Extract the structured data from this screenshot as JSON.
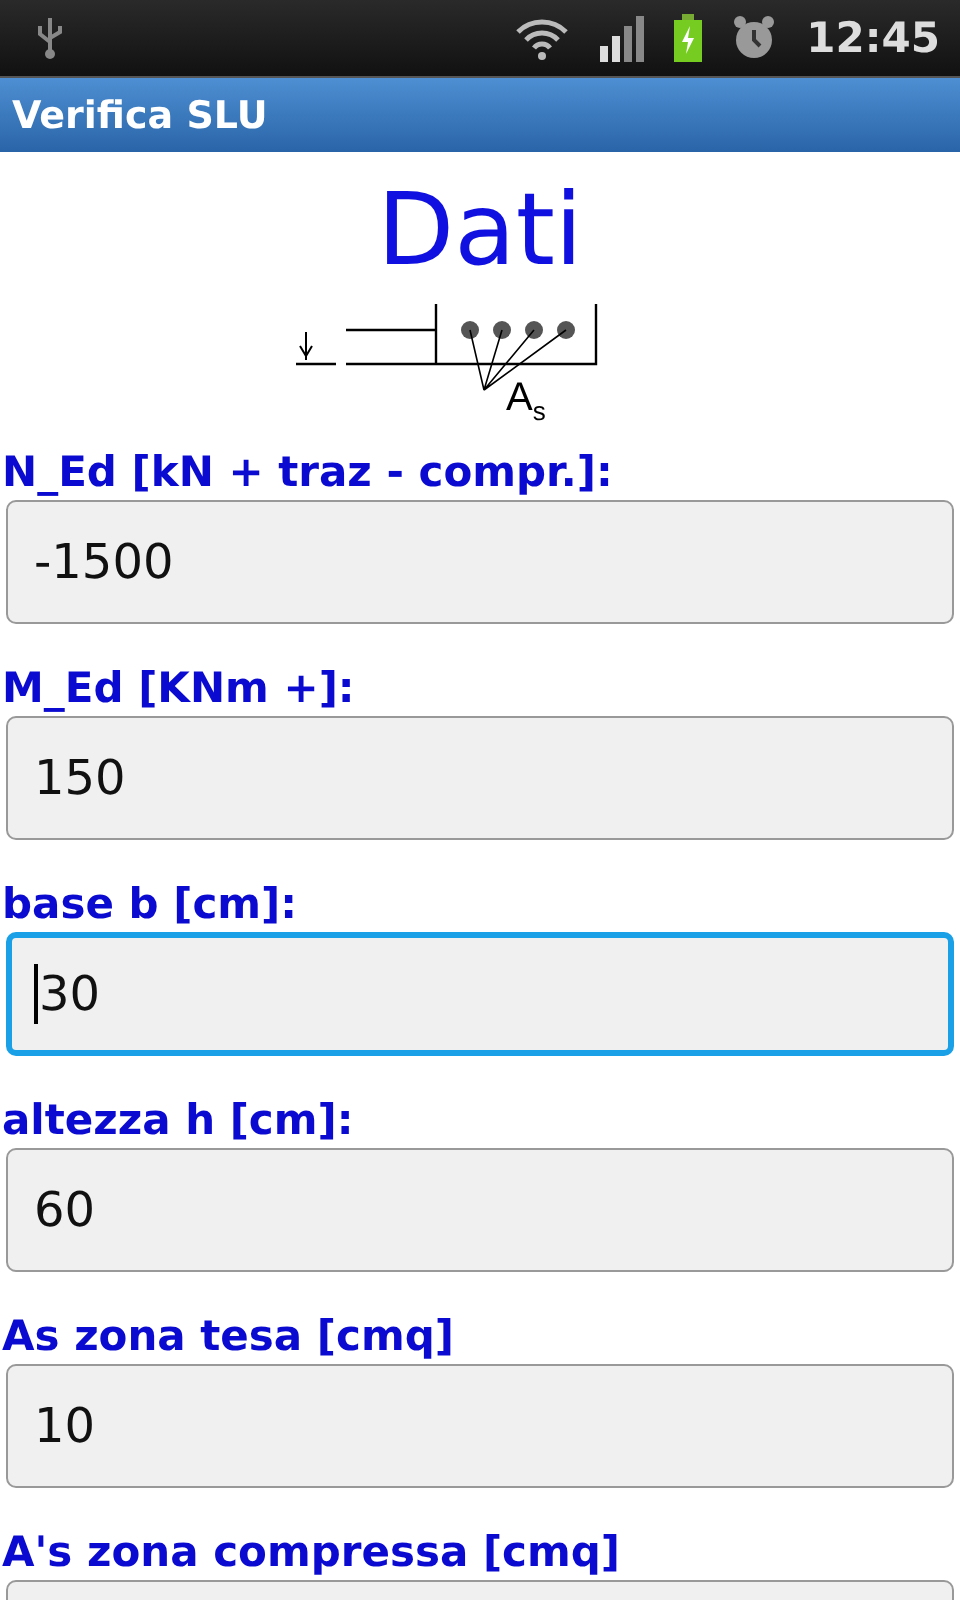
{
  "status_bar": {
    "time": "12:45"
  },
  "title_bar": {
    "title": "Verifica SLU"
  },
  "heading": "Dati",
  "diagram": {
    "label": "A$_{s}$"
  },
  "fields": [
    {
      "label": "N_Ed [kN + traz - compr.]:",
      "value": "-1500",
      "focused": false
    },
    {
      "label": "M_Ed [KNm +]:",
      "value": "150",
      "focused": false
    },
    {
      "label": "base b [cm]:",
      "value": "30",
      "focused": true
    },
    {
      "label": "altezza h [cm]:",
      "value": "60",
      "focused": false
    },
    {
      "label": "As zona tesa [cmq]",
      "value": "10",
      "focused": false
    },
    {
      "label": "A's zona compressa [cmq]",
      "focused": false
    }
  ]
}
